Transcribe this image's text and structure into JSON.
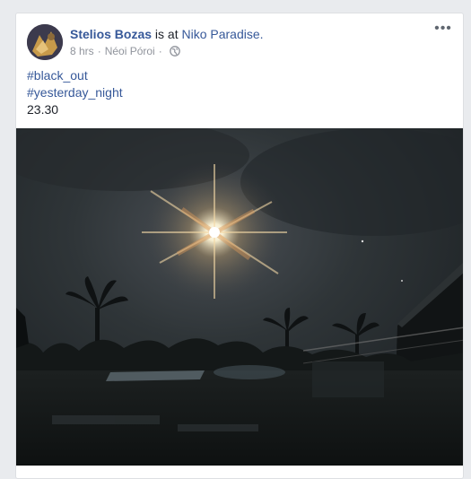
{
  "post": {
    "author": "Stelios Bozas",
    "is_at_text": "is at",
    "place": "Niko Paradise.",
    "time": "8 hrs",
    "location": "Néoi Póroi",
    "separator": "·",
    "privacy_icon": "globe-icon",
    "more_icon": "more-options-icon",
    "more_glyph": "•••",
    "hashtags": [
      "#black_out",
      "#yesterday_night"
    ],
    "caption": "23.30"
  },
  "colors": {
    "link": "#365899",
    "text": "#1d2129",
    "meta": "#90949c",
    "page_bg": "#e9ebee"
  }
}
